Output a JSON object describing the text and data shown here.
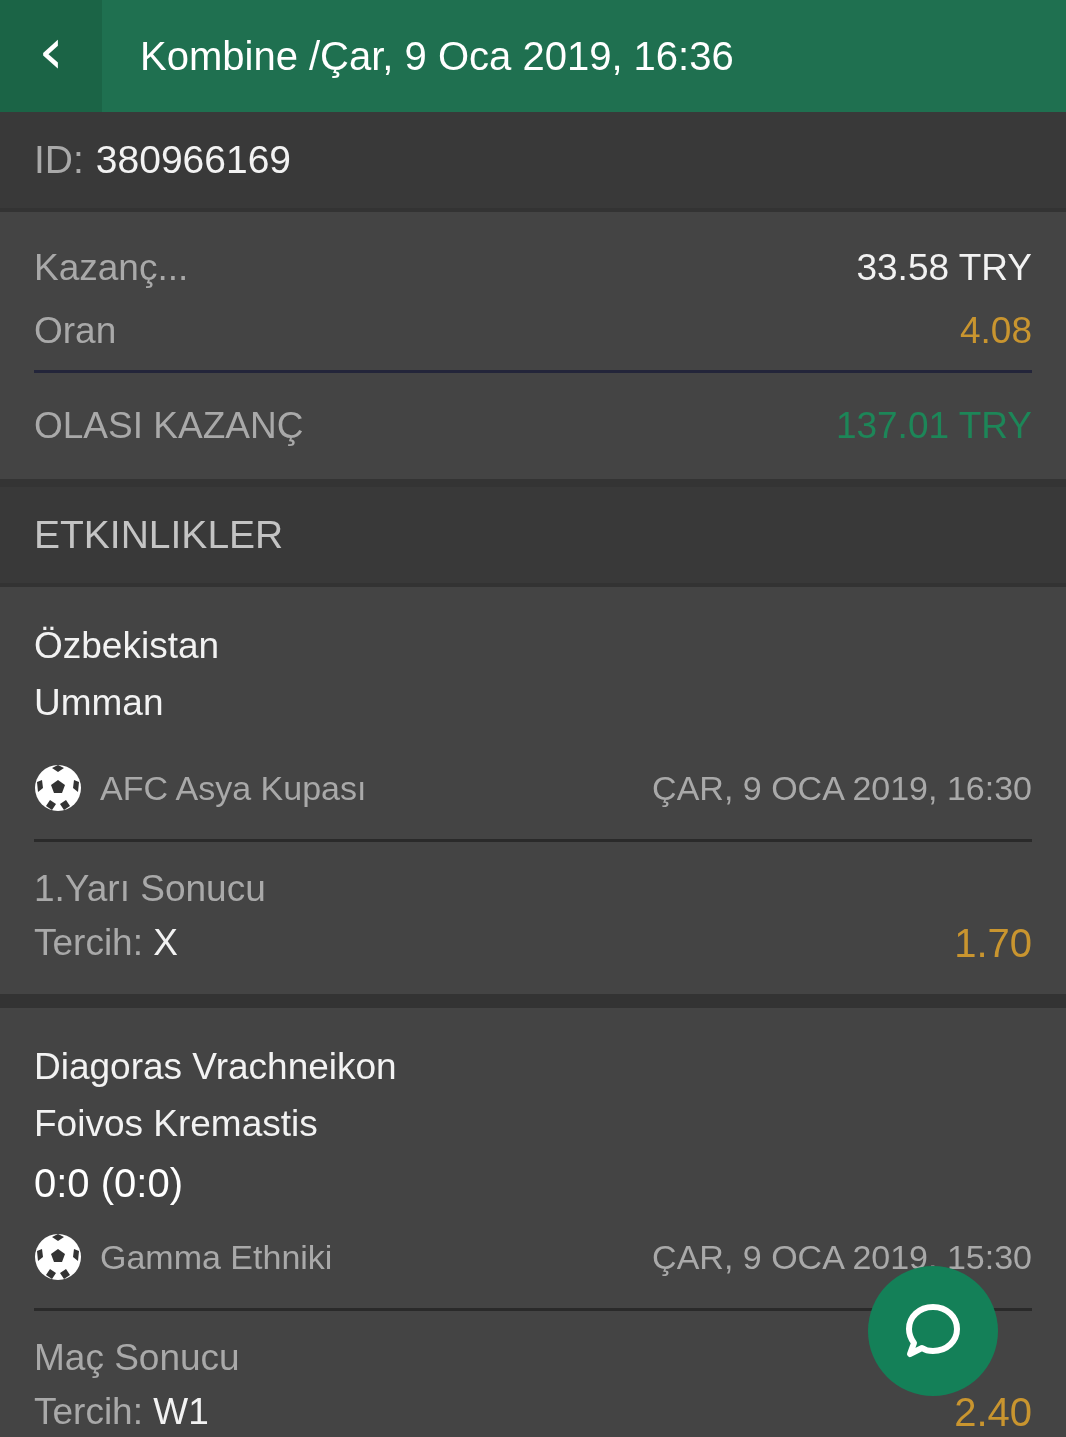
{
  "header": {
    "back_icon": "‹",
    "title": "Kombine /Çar, 9 Oca 2019, 16:36"
  },
  "bet_id": {
    "label": "ID:",
    "value": "380966169"
  },
  "summary": {
    "rows": [
      {
        "label": "Kazanç...",
        "value": "33.58 TRY",
        "kind": "plain"
      },
      {
        "label": "Oran",
        "value": "4.08",
        "kind": "odds"
      }
    ],
    "potential": {
      "label": "OLASI KAZANÇ",
      "value": "137.01 TRY"
    }
  },
  "events_heading": "ETKINLIKLER",
  "events": [
    {
      "teams": [
        "Özbekistan",
        "Umman"
      ],
      "league": "AFC Asya Kupası",
      "date": "ÇAR, 9 OCA 2019, 16:30",
      "market": "1.Yarı Sonucu",
      "pick_label": "Tercih:",
      "pick": "X",
      "odds": "1.70"
    },
    {
      "teams": [
        "Diagoras Vrachneikon",
        "Foivos Kremastis"
      ],
      "score": "0:0 (0:0)",
      "league": "Gamma Ethniki",
      "date": "ÇAR, 9 OCA 2019, 15:30",
      "market": "Maç Sonucu",
      "pick_label": "Tercih:",
      "pick": "W1",
      "odds": "2.40"
    }
  ]
}
